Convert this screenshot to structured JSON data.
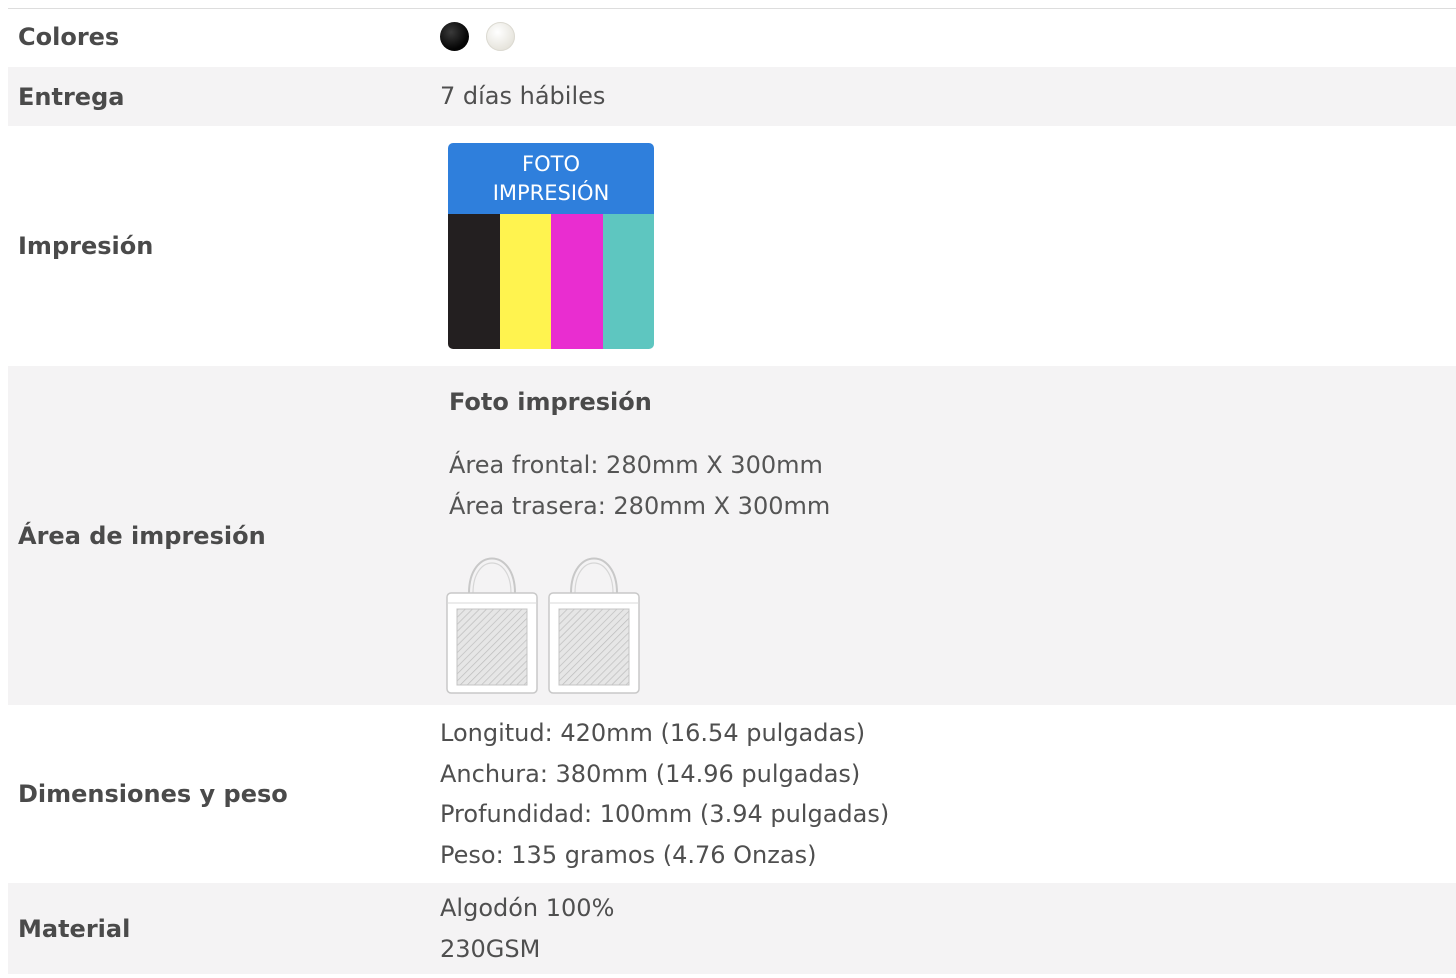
{
  "rows": {
    "colores": {
      "label": "Colores",
      "swatches": [
        "#111111",
        "#e9e7df"
      ]
    },
    "entrega": {
      "label": "Entrega",
      "value": "7 días hábiles"
    },
    "impresion": {
      "label": "Impresión",
      "badge": {
        "line1": "FOTO",
        "line2": "IMPRESIÓN",
        "header_color": "#2f7fdc",
        "bar_colors": [
          "#231f20",
          "#fff34f",
          "#e92dd0",
          "#5ec6c0"
        ]
      }
    },
    "area": {
      "label": "Área de impresión",
      "title": "Foto impresión",
      "front": "Área frontal: 280mm X 300mm",
      "back": "Área trasera: 280mm X 300mm",
      "icons": [
        "tote-bag-front-icon",
        "tote-bag-back-icon"
      ]
    },
    "dimensiones": {
      "label": "Dimensiones y peso",
      "lines": [
        "Longitud: 420mm (16.54 pulgadas)",
        "Anchura: 380mm (14.96 pulgadas)",
        "Profundidad: 100mm (3.94 pulgadas)",
        "Peso: 135 gramos (4.76 Onzas)"
      ]
    },
    "material": {
      "label": "Material",
      "lines": [
        "Algodón 100%",
        "230GSM"
      ]
    }
  }
}
